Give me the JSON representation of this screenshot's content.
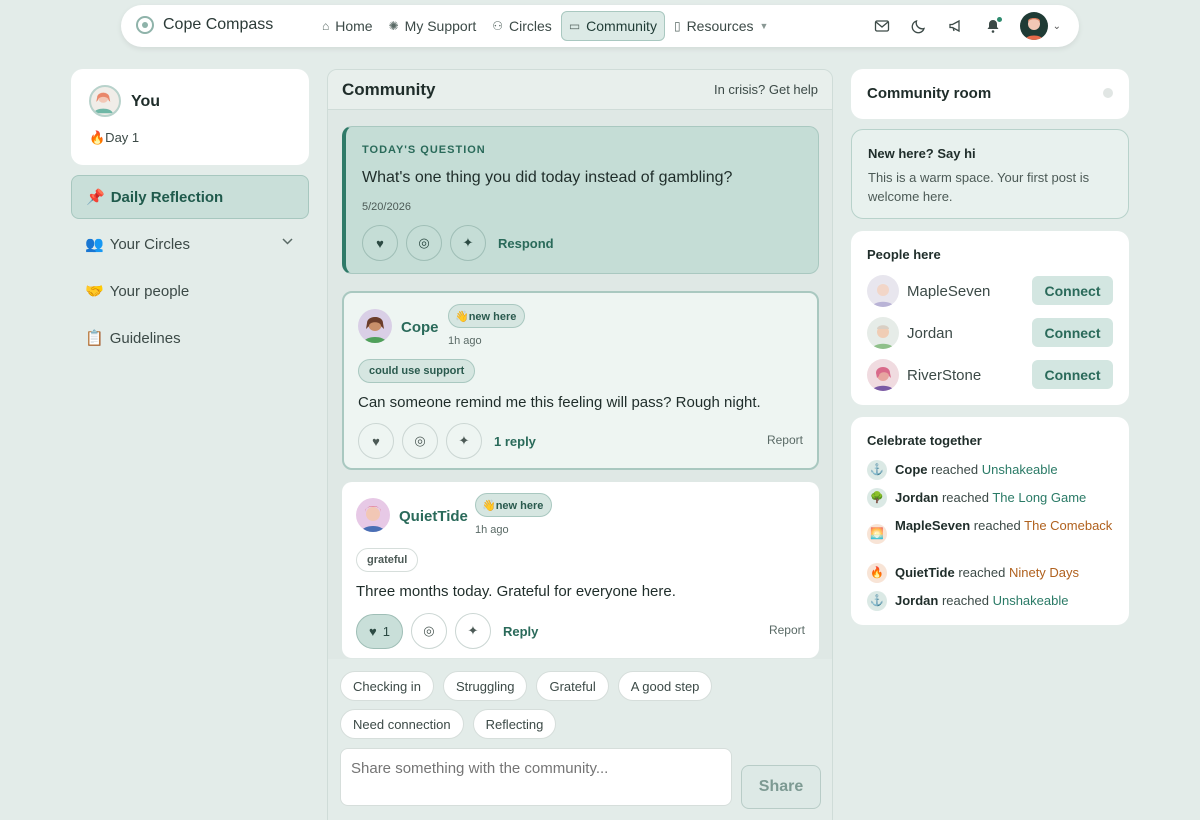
{
  "nav": {
    "brand": "Cope Compass",
    "items": [
      {
        "label": "Home",
        "icon": "⌂",
        "icon_name": "home-icon",
        "active": false
      },
      {
        "label": "My Support",
        "icon": "✺",
        "icon_name": "support-icon",
        "active": false
      },
      {
        "label": "Circles",
        "icon": "⚇",
        "icon_name": "circles-icon",
        "active": false
      },
      {
        "label": "Community",
        "icon": "▭",
        "icon_name": "community-icon",
        "active": true
      },
      {
        "label": "Resources",
        "icon": "▯",
        "icon_name": "resources-icon",
        "active": false,
        "caret": "▼"
      }
    ],
    "icons": [
      "mail-icon",
      "moon-icon",
      "megaphone-icon",
      "bell-icon",
      "avatar"
    ]
  },
  "you": {
    "name": "You",
    "day": "🔥Day 1"
  },
  "sidebar": {
    "items": [
      {
        "emoji": "📌",
        "label": "Daily Reflection",
        "active": true
      },
      {
        "emoji": "👥",
        "label": "Your Circles",
        "has_chevron": true
      },
      {
        "emoji": "🤝",
        "label": "Your people"
      },
      {
        "emoji": "📋",
        "label": "Guidelines"
      }
    ]
  },
  "feed": {
    "title": "Community",
    "crisis_link": "In crisis? Get help",
    "question": {
      "label": "TODAY'S QUESTION",
      "text": "What's one thing you did today instead of gambling?",
      "date": "5/20/2026",
      "respond": "Respond"
    },
    "posts": [
      {
        "author": "Cope",
        "badge": "👋new here",
        "time": "1h ago",
        "tag": "could use support",
        "body": "Can someone remind me this feeling will pass? Rough night.",
        "replies": "1 reply",
        "report": "Report"
      },
      {
        "author": "QuietTide",
        "badge": "👋new here",
        "time": "1h ago",
        "tag": "grateful",
        "body": "Three months today. Grateful for everyone here.",
        "likes": "1",
        "reply": "Reply",
        "report": "Report"
      }
    ],
    "chips": [
      "Checking in",
      "Struggling",
      "Grateful",
      "A good step",
      "Need connection",
      "Reflecting"
    ],
    "composer_placeholder": "Share something with the community...",
    "share": "Share"
  },
  "right": {
    "room_title": "Community room",
    "welcome": {
      "title": "New here? Say hi",
      "text": "This is a warm space. Your first post is welcome here."
    },
    "people_title": "People here",
    "people": [
      {
        "name": "MapleSeven",
        "action": "Connect"
      },
      {
        "name": "Jordan",
        "action": "Connect"
      },
      {
        "name": "RiverStone",
        "action": "Connect"
      }
    ],
    "celebrate_title": "Celebrate together",
    "celebrations": [
      {
        "icon": "⚓",
        "icon_name": "anchor-icon",
        "name": "Cope",
        "verb": "reached",
        "milestone": "Unshakeable",
        "tone": "teal"
      },
      {
        "icon": "🌳",
        "icon_name": "tree-icon",
        "name": "Jordan",
        "verb": "reached",
        "milestone": "The Long Game",
        "tone": "teal"
      },
      {
        "icon": "🌅",
        "icon_name": "sunrise-icon",
        "name": "MapleSeven",
        "verb": "reached",
        "milestone": "The Comeback",
        "tone": "amber"
      },
      {
        "icon": "🔥",
        "icon_name": "fire-icon",
        "name": "QuietTide",
        "verb": "reached",
        "milestone": "Ninety Days",
        "tone": "amber"
      },
      {
        "icon": "⚓",
        "icon_name": "anchor-icon",
        "name": "Jordan",
        "verb": "reached",
        "milestone": "Unshakeable",
        "tone": "teal"
      }
    ]
  },
  "colors": {
    "accent": "#2a6a5a",
    "background": "#e3ece9",
    "question_bg": "#c5ddd6",
    "amber": "#b0611e"
  }
}
